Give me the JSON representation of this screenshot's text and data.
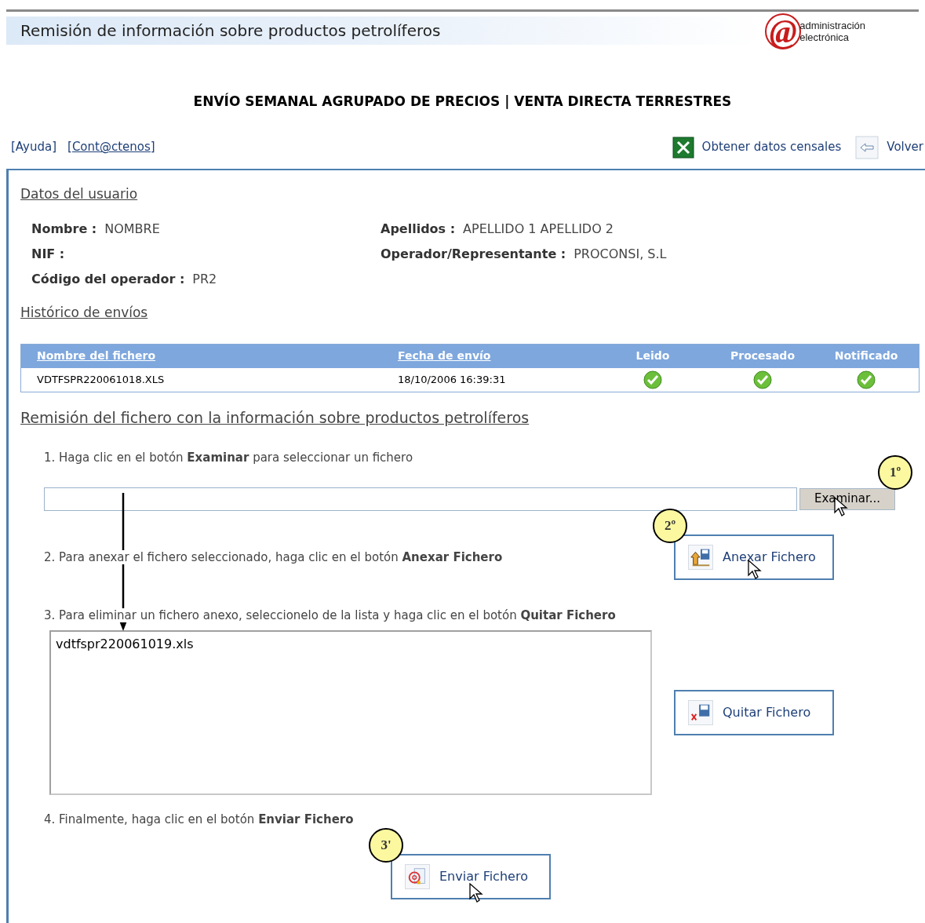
{
  "header": {
    "title": "Remisión de información sobre productos petrolíferos",
    "logo_mark": "@",
    "logo_lines": [
      "administración",
      "electrónica"
    ]
  },
  "page_title": "ENVÍO SEMANAL AGRUPADO DE PRECIOS | VENTA DIRECTA TERRESTRES",
  "links": [
    "[Ayuda]",
    "[Cont@ctenos]"
  ],
  "actions": [
    {
      "kind": "excel",
      "label": "Obtener datos censales"
    },
    {
      "kind": "back",
      "label": "Volver"
    }
  ],
  "user_section": {
    "title": "Datos del usuario",
    "fields": [
      {
        "label": "Nombre :",
        "value": "NOMBRE"
      },
      {
        "label": "Apellidos :",
        "value": "APELLIDO 1 APELLIDO 2"
      },
      {
        "label": "NIF :"
      },
      {
        "label": "Operador/Representante :",
        "value": "PROCONSI, S.L"
      },
      {
        "label": "Código del operador :",
        "value": "PR2"
      }
    ]
  },
  "history": {
    "title": "Histórico de envíos",
    "columns": [
      "Nombre del fichero",
      "Fecha de envío",
      "Leido",
      "Procesado",
      "Notificado"
    ],
    "rows": [
      {
        "file": "VDTFSPR220061018.XLS",
        "date": "18/10/2006 16:39:31",
        "read": true,
        "processed": true,
        "notified": true
      }
    ]
  },
  "upload": {
    "title": "Remisión del fichero con la información sobre productos petrolíferos",
    "steps": [
      "1. Haga clic en el botón **Examinar** para seleccionar un fichero",
      "2. Para anexar el fichero seleccionado, haga clic en el botón **Anexar Fichero**",
      "3. Para eliminar un fichero anexo, seleccionelo de la lista y haga clic en el botón **Quitar Fichero**",
      "4. Finalmente, haga clic en el botón **Enviar Fichero**"
    ],
    "browse_button": "Examinar...",
    "attach_button": "Anexar Fichero",
    "files": [
      {
        "name": "vdtfspr220061019.xls",
        "selected": false
      }
    ],
    "remove_button": "Quitar Fichero",
    "send_button": "Enviar Fichero"
  },
  "callouts": [
    "1º",
    "2º",
    "3'"
  ]
}
